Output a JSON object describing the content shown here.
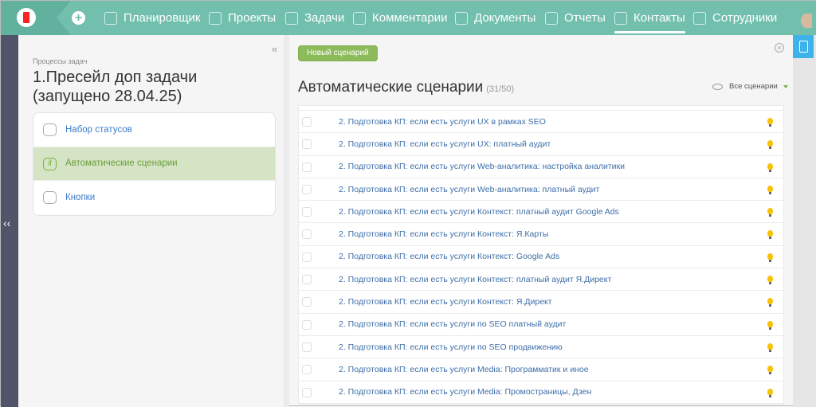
{
  "nav": {
    "items": [
      {
        "label": "Планировщик",
        "icon": "planner-icon"
      },
      {
        "label": "Проекты",
        "icon": "briefcase-icon"
      },
      {
        "label": "Задачи",
        "icon": "task-icon"
      },
      {
        "label": "Комментарии",
        "icon": "layers-icon"
      },
      {
        "label": "Документы",
        "icon": "document-icon"
      },
      {
        "label": "Отчеты",
        "icon": "chart-icon"
      },
      {
        "label": "Контакты",
        "icon": "contact-icon",
        "active": true
      },
      {
        "label": "Сотрудники",
        "icon": "users-icon"
      }
    ]
  },
  "left": {
    "crumb": "Процессы задач",
    "title": "1.Пресейл доп задачи (запущено 28.04.25)",
    "collapse": "«",
    "expand": "‹‹",
    "menu": [
      {
        "label": "Набор статусов"
      },
      {
        "label": "Автоматические сценарии",
        "icon_text": "if"
      },
      {
        "label": "Кнопки"
      }
    ]
  },
  "main": {
    "new_button": "Новый сценарий",
    "close": "×",
    "title": "Автоматические сценарии",
    "count": "(31/50)",
    "filter": "Все сценарии",
    "rows": [
      "2. Подготовка КП: если есть услуги UX в рамках SEO",
      "2. Подготовка КП: если есть услуги UX: платный аудит",
      "2. Подготовка КП: если есть услуги Web-аналитика: настройка аналитики",
      "2. Подготовка КП: если есть услуги Web-аналитика: платный аудит",
      "2. Подготовка КП: если есть услуги Контекст: платный аудит Google Ads",
      "2. Подготовка КП: если есть услуги Контекст: Я.Карты",
      "2. Подготовка КП: если есть услуги Контекст: Google Ads",
      "2. Подготовка КП: если есть услуги Контекст: платный аудит Я.Директ",
      "2. Подготовка КП: если есть услуги Контекст: Я.Директ",
      "2. Подготовка КП: если есть услуги по SEO платный аудит",
      "2. Подготовка КП: если есть услуги по SEO продвижению",
      "2. Подготовка КП: если есть услуги Media: Программатик и иное",
      "2. Подготовка КП: если есть услуги Media: Промостраницы, Дзен"
    ]
  }
}
